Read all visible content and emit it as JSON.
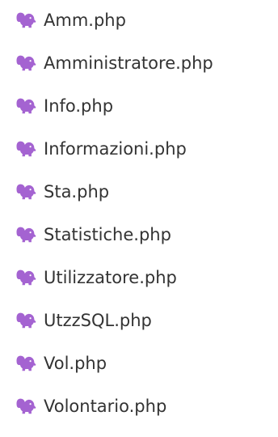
{
  "icon_name": "php-elephant-icon",
  "icon_color": "#a463d1",
  "text_color": "#333333",
  "files": [
    {
      "name": "Amm.php"
    },
    {
      "name": "Amministratore.php"
    },
    {
      "name": "Info.php"
    },
    {
      "name": "Informazioni.php"
    },
    {
      "name": "Sta.php"
    },
    {
      "name": "Statistiche.php"
    },
    {
      "name": "Utilizzatore.php"
    },
    {
      "name": "UtzzSQL.php"
    },
    {
      "name": "Vol.php"
    },
    {
      "name": "Volontario.php"
    }
  ]
}
